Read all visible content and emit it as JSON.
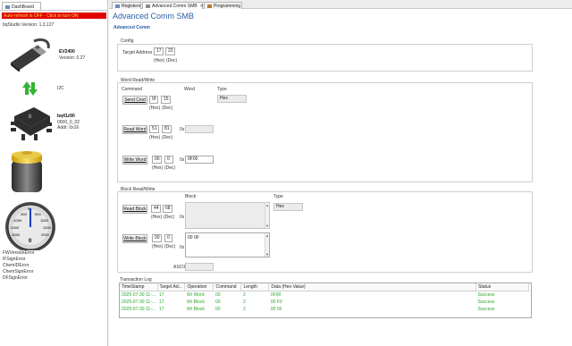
{
  "dashboard": {
    "tab_label": "DashBoard",
    "auto_bar_text": "Auto-refresh is OFF - Click to turn ON",
    "version_label": "bqStudio Version:  1.3.127",
    "ev_name": "EV2400",
    "ev_version": "Version: 0.27",
    "comm_label": "I2C",
    "device_name": "bq41z90",
    "device_fw": "0000_0_02",
    "device_addr": "Addr: 0x16",
    "gauge_ticks": [
      "0",
      "-500",
      "500",
      "-1000",
      "1000",
      "-1500",
      "1500",
      "-2000",
      "2000"
    ],
    "gauge_value": "0",
    "errors": [
      "FWVersionError",
      "IFSignError",
      "ChemIDError",
      "ChemSignError",
      "DFSignError"
    ]
  },
  "tabs": [
    {
      "label": "Registers"
    },
    {
      "label": "Advanced Comm SMB",
      "close": "✕"
    },
    {
      "label": "Programming"
    }
  ],
  "page": {
    "title": "Advanced Comm SMB",
    "section": "Advanced Comm"
  },
  "config": {
    "title": "Config",
    "target_label": "Target Address",
    "target_hex": "17",
    "target_dec": "23",
    "hex_unit": "(Hex)",
    "dec_unit": "(Dec)"
  },
  "word": {
    "title": "Word Read/Write",
    "col_command": "Command",
    "col_word": "Word",
    "col_type": "Type",
    "type_value": "Hex",
    "send_cmd_label": "Send Cmd",
    "send_hex": "0f",
    "send_dec": "15",
    "read_word_label": "Read Word",
    "read_hex": "51",
    "read_dec": "81",
    "read_prefix": "0x",
    "read_value": "",
    "write_word_label": "Write Word",
    "write_hex": "00",
    "write_dec": "0",
    "write_prefix": "0x",
    "write_value": "0F00",
    "hex_unit": "(Hex)",
    "dec_unit": "(Dec)"
  },
  "block": {
    "title": "Block Read/Write",
    "col_block": "Block",
    "col_type": "Type",
    "type_value": "Hex",
    "read_block_label": "Read Block",
    "read_hex": "44",
    "read_dec": "68",
    "read_prefix": "0x",
    "read_value": "",
    "write_block_label": "Write Block",
    "write_hex": "00",
    "write_dec": "0",
    "write_prefix": "0x",
    "write_value": "00 0F",
    "ascii_label": "ASCII",
    "ascii_value": "",
    "hex_unit": "(Hex)",
    "dec_unit": "(Dec)"
  },
  "log": {
    "title": "Transaction Log",
    "columns": [
      "TimeStamp",
      "Target Ad...",
      "Operation",
      "Command",
      "Length",
      "Data (Hex-Value)",
      "Status"
    ],
    "rows": [
      [
        "2025-07-30 11-...",
        "17",
        "Wr Word",
        "00",
        "2",
        "0F00",
        "Success"
      ],
      [
        "2025-07-30 11-...",
        "17",
        "Wr Block",
        "00",
        "2",
        "00 F0",
        "Success"
      ],
      [
        "2025-07-30 11-...",
        "17",
        "Wr Block",
        "00",
        "2",
        "00 0F",
        "Success"
      ]
    ]
  },
  "colors": {
    "accent": "#2a5ea6",
    "error_bar": "#e00000",
    "success": "#2aa52a"
  }
}
